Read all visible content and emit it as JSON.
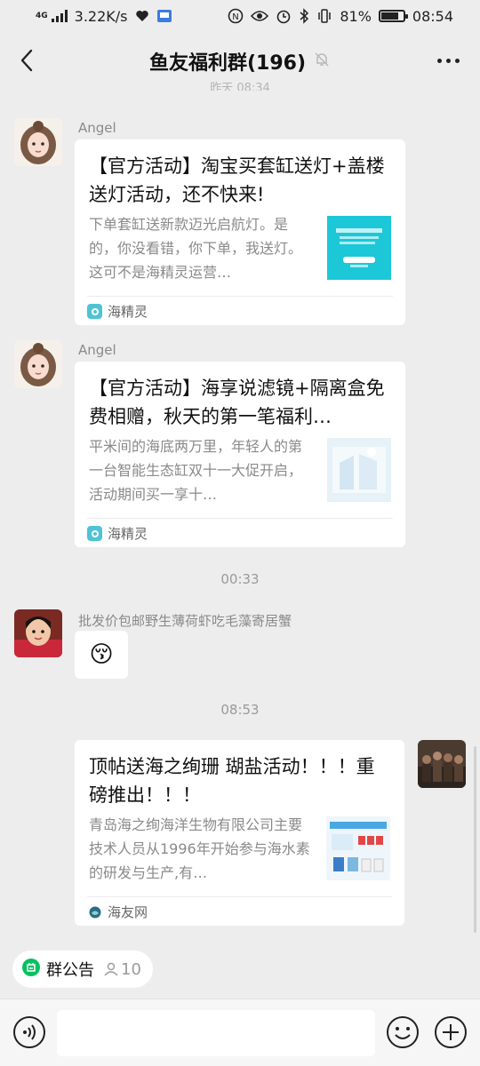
{
  "status_bar": {
    "network_type": "4G",
    "speed": "3.22K/s",
    "battery_percent": "81%",
    "time": "08:54",
    "battery_level": 0.81,
    "icons": [
      "signal-icon",
      "heart-icon",
      "app-icon",
      "nfc-icon",
      "eye-icon",
      "alarm-icon",
      "bluetooth-icon",
      "vibrate-icon",
      "battery-icon"
    ]
  },
  "header": {
    "title": "鱼友福利群(196)",
    "muted_icon": "bell-off-icon"
  },
  "clipped_timestamp": "昨天 08:34",
  "messages": [
    {
      "sender": "Angel",
      "card": {
        "title": "【官方活动】淘宝买套缸送灯+盖楼送灯活动，还不快来!",
        "desc": "下单套缸送新款迈光启航灯。是的，你没看错，你下单，我送灯。这可不是海精灵运营…",
        "source": "海精灵"
      }
    },
    {
      "sender": "Angel",
      "card": {
        "title": "【官方活动】海享说滤镜+隔离盒免费相赠，秋天的第一笔福利…",
        "desc": "平米间的海底两万里，年轻人的第一台智能生态缸双十一大促开启，活动期间买一享十…",
        "source": "海精灵"
      }
    }
  ],
  "time_sep_1": "00:33",
  "emoji_msg": {
    "sender": "批发价包邮野生薄荷虾吃毛藻寄居蟹",
    "emoji": "😚"
  },
  "time_sep_2": "08:53",
  "own_msg": {
    "card": {
      "title": "顶帖送海之绚珊 瑚盐活动！！！重磅推出！！！",
      "desc": "青岛海之绚海洋生物有限公司主要技术人员从1996年开始参与海水素的研发与生产,有…",
      "source": "海友网"
    }
  },
  "announcement": {
    "label": "群公告",
    "count": "10"
  },
  "colors": {
    "background": "#ededed",
    "wechat_green": "#07c160",
    "card_source_teal": "#4fc3d4"
  }
}
